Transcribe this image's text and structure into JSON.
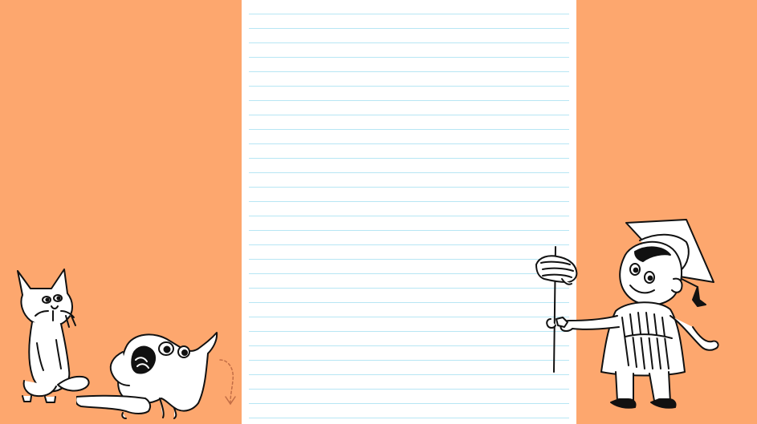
{
  "colors": {
    "background": "#fda76e",
    "paper": "#ffffff",
    "rule_line": "#b7e6f4",
    "ink": "#111111"
  },
  "illustrations": {
    "left": [
      "cat-icon",
      "pug-icon",
      "drip-arrow-icon"
    ],
    "right": [
      "graduate-icon",
      "scroll-icon"
    ]
  }
}
